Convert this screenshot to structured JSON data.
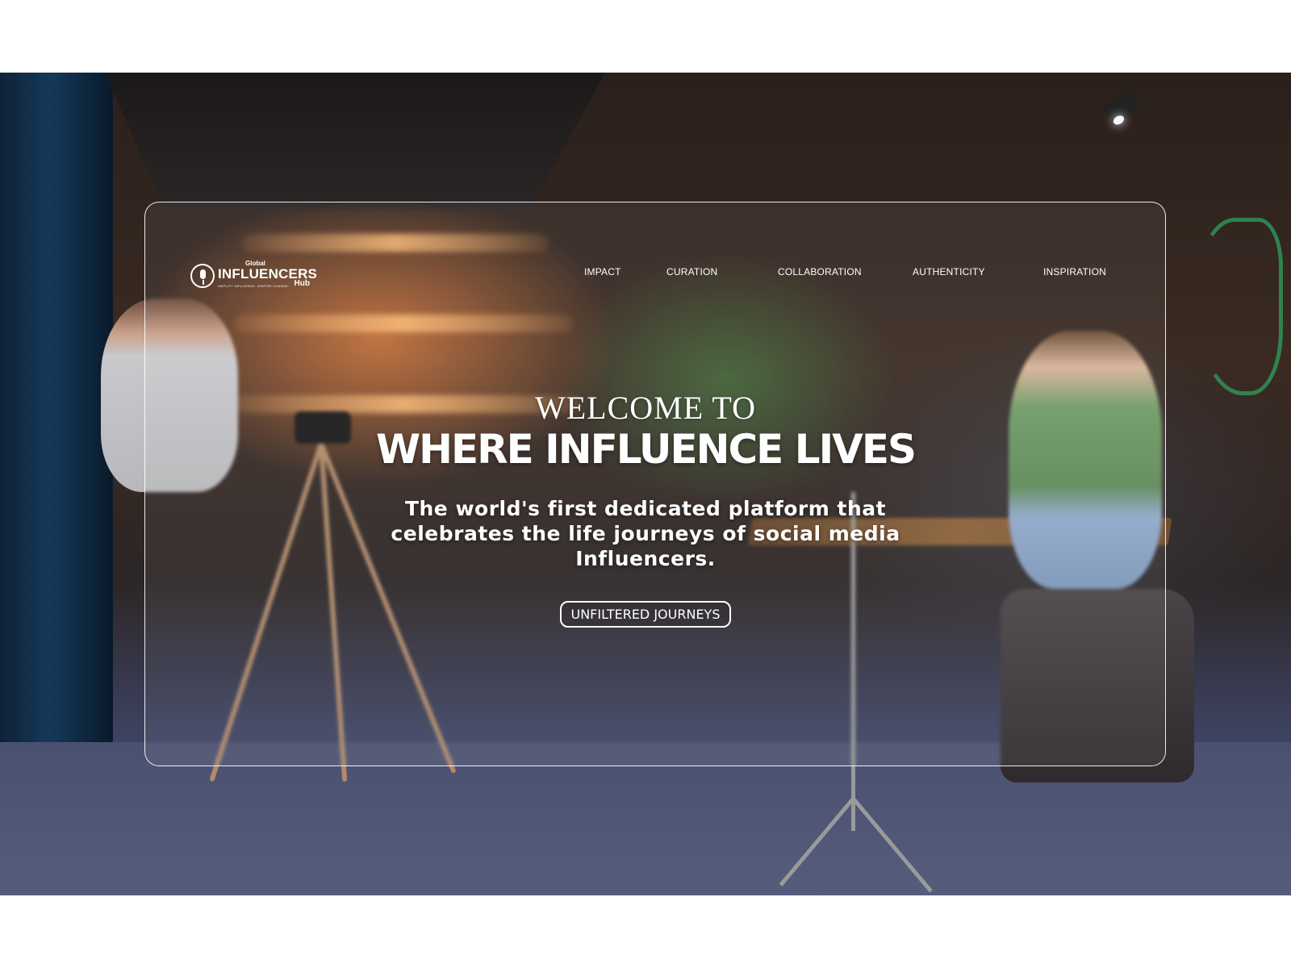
{
  "brand": {
    "small": "Global",
    "name": "INFLUENCERS",
    "suffix": "Hub",
    "tagline": "AMPLIFY INFLUENCE. INSPIRE CHANGE."
  },
  "nav": {
    "items": [
      {
        "label": "IMPACT"
      },
      {
        "label": "CURATION"
      },
      {
        "label": "COLLABORATION"
      },
      {
        "label": "AUTHENTICITY"
      },
      {
        "label": "INSPIRATION"
      }
    ]
  },
  "hero": {
    "welcome": "WELCOME TO",
    "headline": "WHERE INFLUENCE LIVES",
    "subtitle": "The world's first dedicated platform that celebrates the life journeys of social media Influencers.",
    "cta_label": "UNFILTERED JOURNEYS"
  },
  "icons": {
    "logo": "microphone-icon"
  },
  "colors": {
    "text": "#ffffff",
    "page_background": "#ffffff",
    "frame_border": "#ffffff"
  }
}
